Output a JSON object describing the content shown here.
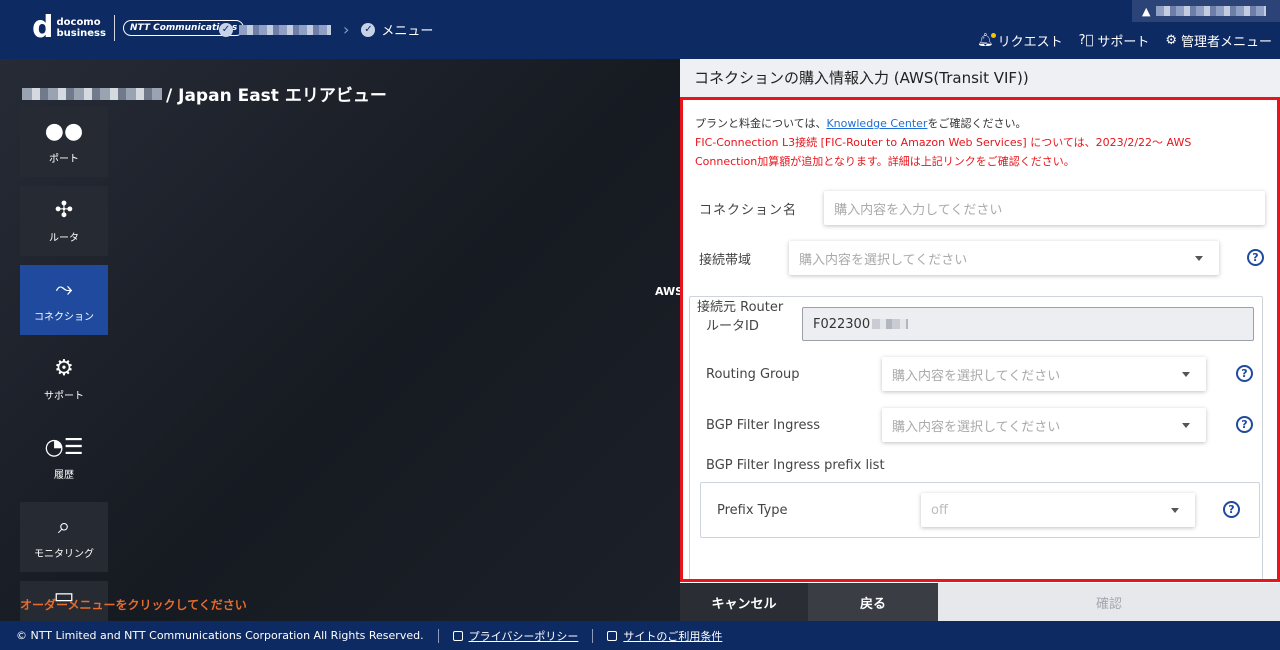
{
  "header": {
    "logo_d": "d",
    "logo_line1": "docomo",
    "logo_line2": "business",
    "ntt_logo": "NTT Communications",
    "breadcrumb_menu": "メニュー",
    "links": [
      {
        "label": "リクエスト",
        "icon": "bell-icon"
      },
      {
        "label": "サポート",
        "icon": "question-icon"
      },
      {
        "label": "管理者メニュー",
        "icon": "gear-icon"
      }
    ]
  },
  "main": {
    "area_title": "/ Japan East エリアビュー",
    "aws_label": "AWS",
    "click_hint": "オーダーメニューをクリックしてください",
    "nav": [
      {
        "label": "ポート",
        "icon": "●●"
      },
      {
        "label": "ルータ",
        "icon": "✣"
      },
      {
        "label": "コネクション",
        "icon": "⤳"
      },
      {
        "label": "サポート",
        "icon": "⚙"
      },
      {
        "label": "履歴",
        "icon": "◔☰"
      },
      {
        "label": "モニタリング",
        "icon": "⌕"
      },
      {
        "label": "",
        "icon": "▭"
      }
    ]
  },
  "panel": {
    "title": "コネクションの購入情報入力 (AWS(Transit VIF))",
    "info_prefix": "プランと料金については、",
    "info_link": "Knowledge Center",
    "info_suffix": "をご確認ください。",
    "warning_line1": "FIC-Connection L3接続 [FIC-Router to Amazon Web Services] については、2023/2/22～ AWS",
    "warning_line2": "Connection加算額が追加となります。詳細は上記リンクをご確認ください。",
    "connection_name_label": "コネクション名",
    "connection_name_placeholder": "購入内容を入力してください",
    "bandwidth_label": "接続帯域",
    "bandwidth_placeholder": "購入内容を選択してください",
    "source_router_label": "接続元 Router",
    "router_id_label": "ルータID",
    "router_id_value": "F022300",
    "routing_group_label": "Routing Group",
    "routing_group_placeholder": "購入内容を選択してください",
    "bgp_filter_label": "BGP Filter Ingress",
    "bgp_filter_placeholder": "購入内容を選択してください",
    "bgp_prefix_label": "BGP Filter Ingress prefix list",
    "prefix_type_label": "Prefix Type",
    "prefix_type_value": "off",
    "help_symbol": "?"
  },
  "buttons": {
    "cancel": "キャンセル",
    "back": "戻る",
    "confirm": "確認"
  },
  "footer": {
    "copyright": "© NTT Limited and NTT Communications Corporation All Rights Reserved.",
    "privacy": "プライバシーポリシー",
    "terms": "サイトのご利用条件"
  },
  "colors": {
    "header_bg": "#0d2a63",
    "highlight_border": "#e8141b",
    "active_nav": "#1f4a9e",
    "warning_text": "#e8141b"
  }
}
